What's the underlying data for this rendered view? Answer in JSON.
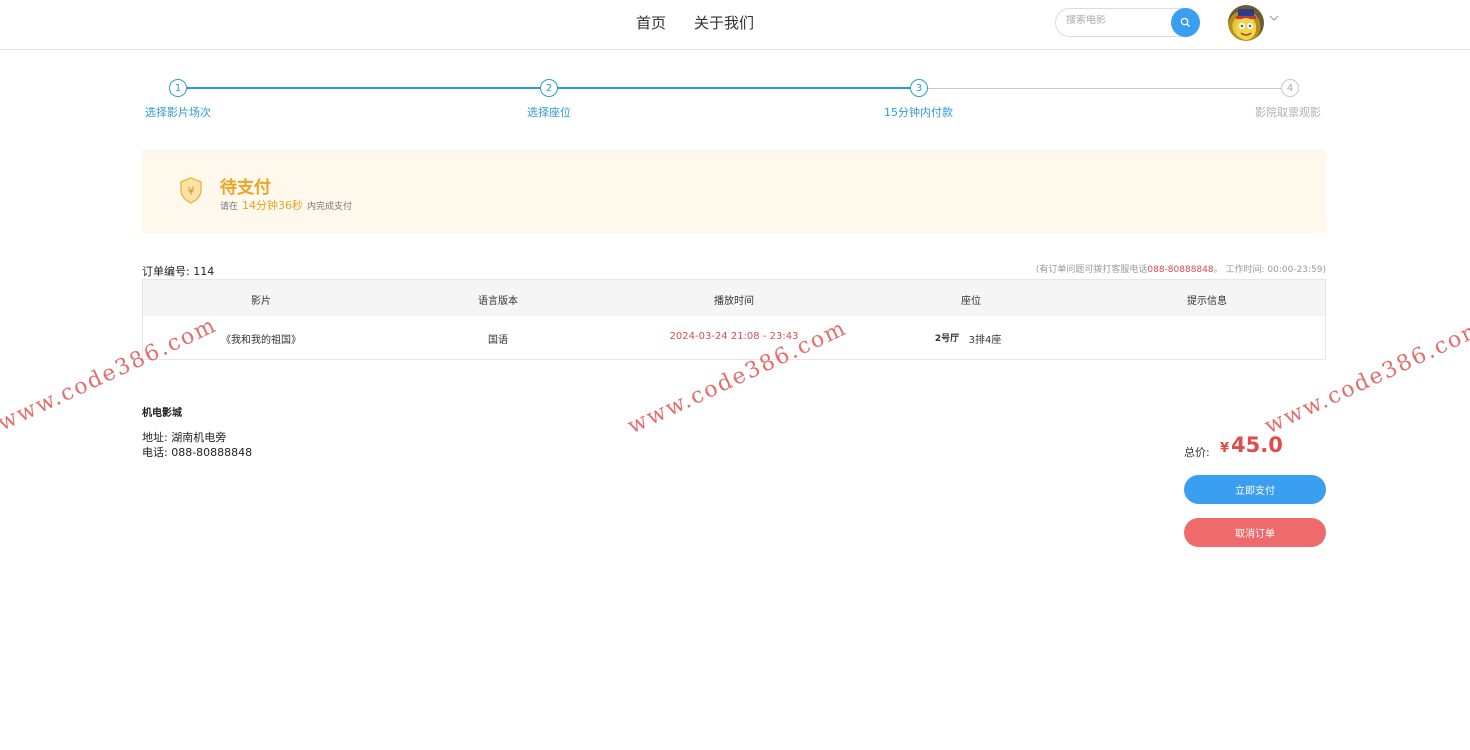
{
  "header": {
    "nav": [
      "首页",
      "关于我们"
    ],
    "search": {
      "placeholder": "搜索电影"
    }
  },
  "steps": [
    {
      "num": "1",
      "label": "选择影片场次",
      "active": true
    },
    {
      "num": "2",
      "label": "选择座位",
      "active": true
    },
    {
      "num": "3",
      "label": "15分钟内付款",
      "active": true
    },
    {
      "num": "4",
      "label": "影院取票观影",
      "active": false
    }
  ],
  "status": {
    "title": "待支付",
    "sub_prefix": "请在",
    "countdown": "14分钟36秒",
    "sub_suffix": "内完成支付"
  },
  "order": {
    "number_label": "订单编号: 114",
    "hint_prefix": "(有订单问题可拨打客服电话",
    "hint_phone": "088-80888848",
    "hint_suffix": "。 工作时间: 00:00-23:59)"
  },
  "table": {
    "headers": [
      "影片",
      "语言版本",
      "播放时间",
      "座位",
      "提示信息"
    ],
    "row": {
      "film": "《我和我的祖国》",
      "language": "国语",
      "showtime": "2024-03-24 21:08 - 23:43",
      "hall": "2号厅",
      "seat": "3排4座",
      "tip": ""
    }
  },
  "cinema": {
    "name": "机电影城",
    "address": "地址: 湖南机电旁",
    "phone": "电话: 088-80888848"
  },
  "payment": {
    "total_label": "总价:",
    "currency": "¥",
    "total": "45.0",
    "pay_label": "立即支付",
    "cancel_label": "取消订单"
  },
  "watermark": "www.code386.com",
  "colors": {
    "accent": "#3a9ff0",
    "step": "#2e9bd6",
    "warning": "#e9a422",
    "danger": "#e04b4b"
  }
}
